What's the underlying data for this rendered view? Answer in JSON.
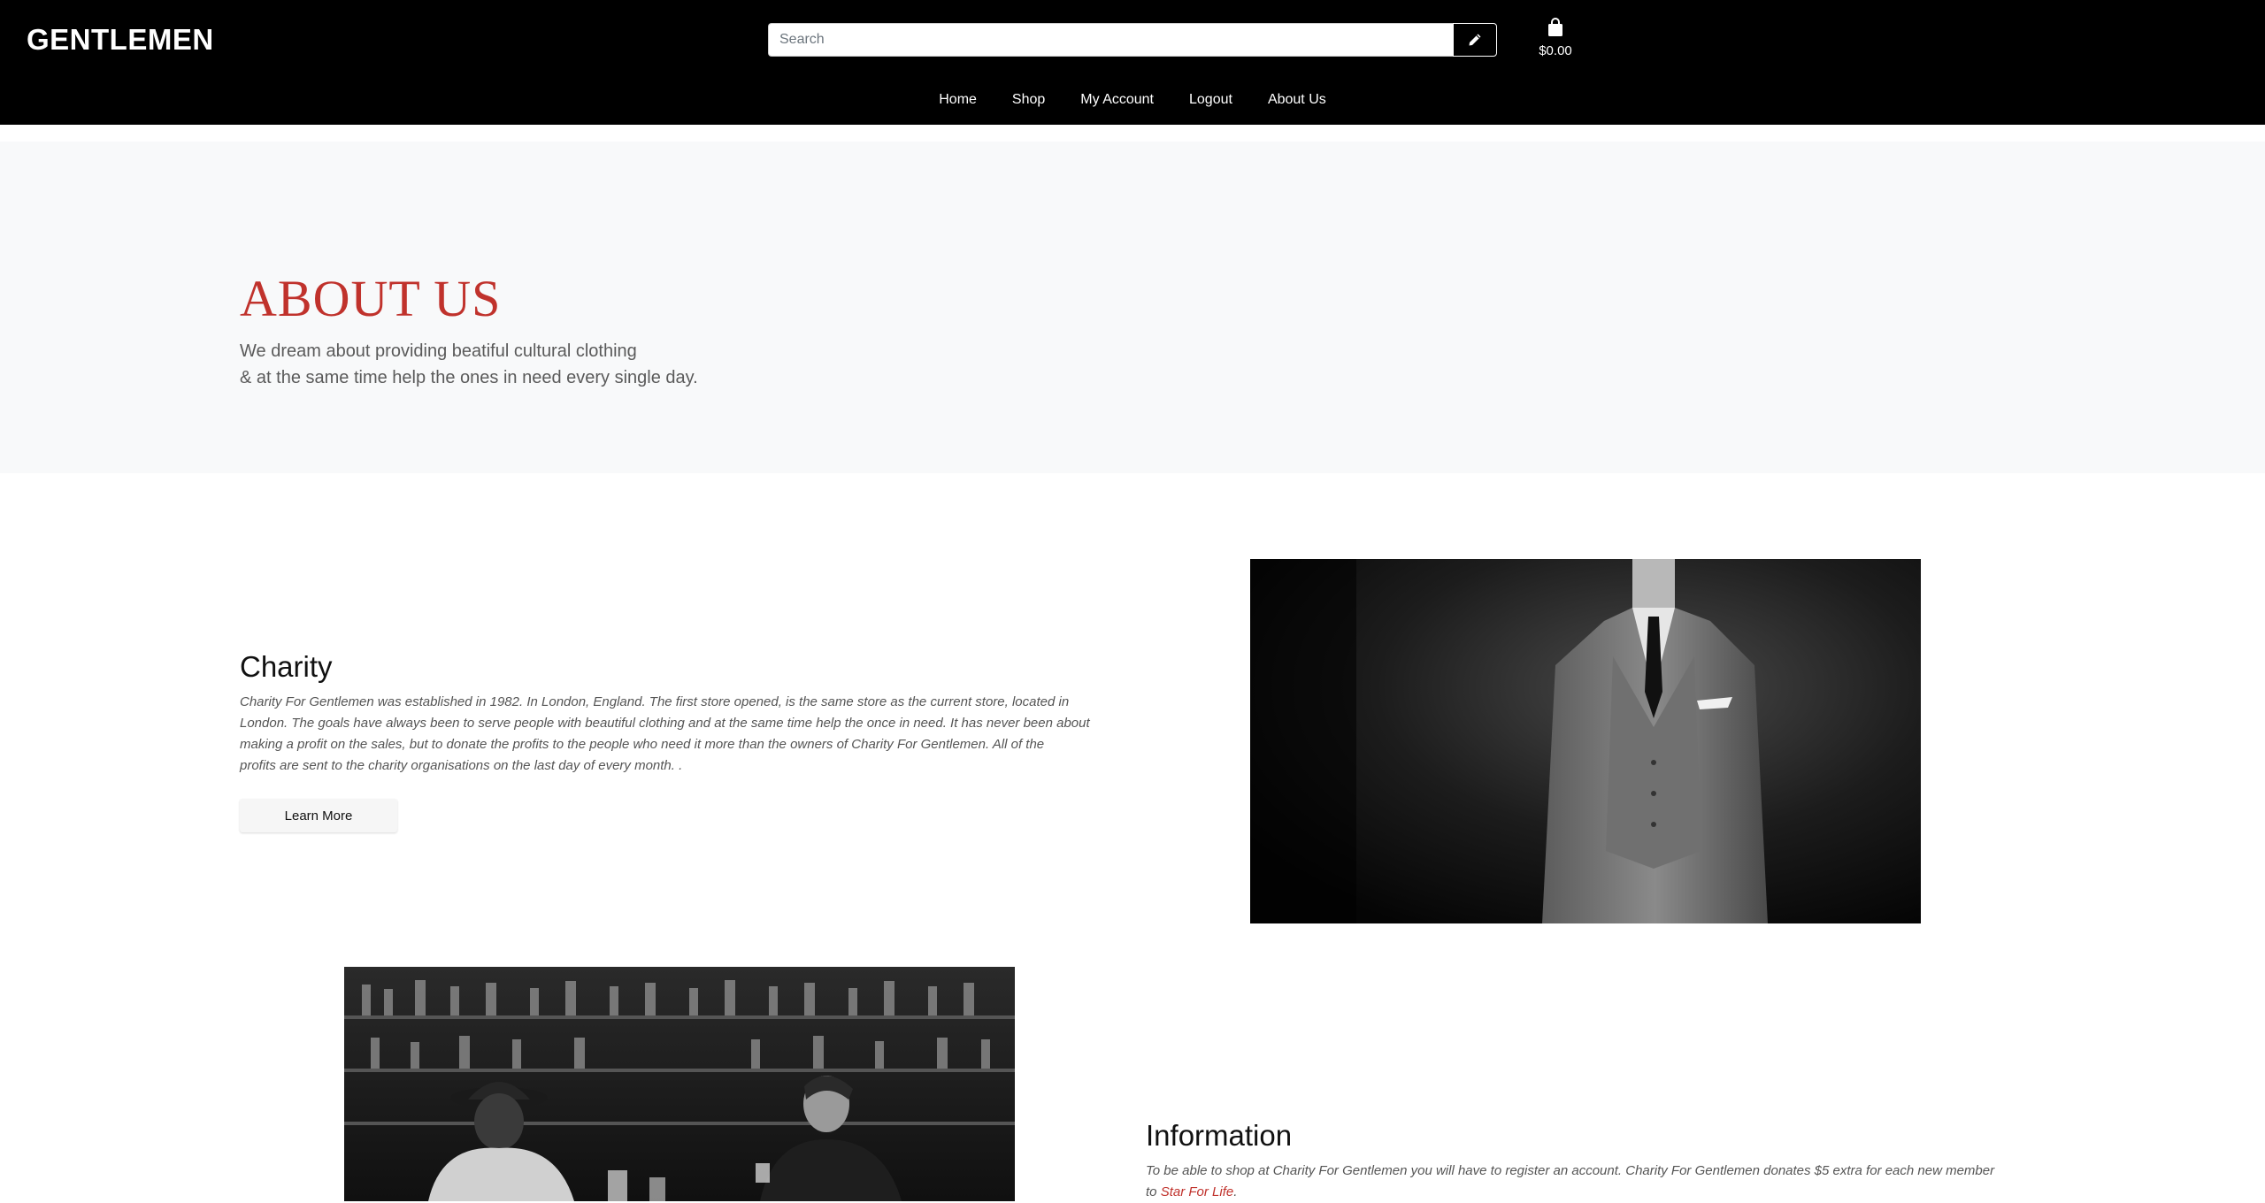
{
  "header": {
    "brand": "GENTLEMEN",
    "search_placeholder": "Search",
    "cart_amount": "$0.00",
    "search_icon": "pencil-icon",
    "cart_icon": "shopping-bag-icon"
  },
  "nav": {
    "items": [
      {
        "label": "Home"
      },
      {
        "label": "Shop"
      },
      {
        "label": "My Account"
      },
      {
        "label": "Logout"
      },
      {
        "label": "About Us"
      }
    ]
  },
  "hero": {
    "title": "ABOUT US",
    "line1": "We dream about providing beatiful cultural clothing",
    "line2": "& at the same time help the ones in need every single day."
  },
  "charity": {
    "title": "Charity",
    "line1": "Charity For Gentlemen was established in 1982. In London, England. The first store opened, is the same store as the current store, located in",
    "line2": "London. The goals have always been to serve people with beautiful clothing and at the same time help the once in need. It has never been about",
    "line3": "making a profit on the sales, but to donate the profits to the people who need it more than the owners of Charity For Gentlemen. All of the",
    "line4": "profits are sent to the charity organisations on the last day of every month. .",
    "button": "Learn More"
  },
  "information": {
    "title": "Information",
    "line1": "To be able to shop at Charity For Gentlemen you will have to register an account. Charity For Gentlemen donates $5 extra for each new member",
    "line2_prefix": "to ",
    "line2_link": "Star For Life",
    "line2_suffix": "."
  },
  "colors": {
    "accent": "#c0322c",
    "header_bg": "#000000",
    "hero_bg": "#f8f9fa"
  }
}
